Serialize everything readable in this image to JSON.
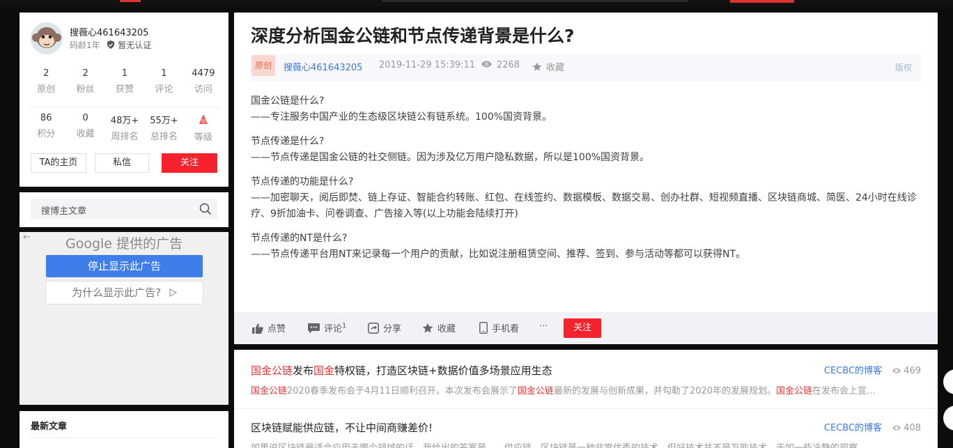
{
  "sidebar": {
    "profile": {
      "username": "搜薇心461643205",
      "code_age": "码龄1年",
      "verify": "暂无认证",
      "stats_row1": [
        {
          "num": "2",
          "label": "原创"
        },
        {
          "num": "2",
          "label": "粉丝"
        },
        {
          "num": "1",
          "label": "获赞"
        },
        {
          "num": "1",
          "label": "评论"
        },
        {
          "num": "4479",
          "label": "访问"
        }
      ],
      "stats_row2": [
        {
          "num": "86",
          "label": "积分"
        },
        {
          "num": "0",
          "label": "收藏"
        },
        {
          "num": "48万+",
          "label": "周排名"
        },
        {
          "num": "55万+",
          "label": "总排名"
        },
        {
          "num": "",
          "label": "等级"
        }
      ],
      "homepage_label": "TA的主页",
      "message_label": "私信",
      "follow_label": "关注"
    },
    "search": {
      "placeholder": "搜博主文章"
    },
    "ad": {
      "google_label": "Google 提供的广告",
      "stop_label": "停止显示此广告",
      "why_label": "为什么显示此广告?"
    },
    "recent": {
      "title": "最新文章"
    }
  },
  "article": {
    "title": "深度分析国金公链和节点传递背景是什么?",
    "badge": "原创",
    "author": "搜薇心461643205",
    "time": "2019-11-29 15:39:11",
    "views": "2268",
    "favorite": "收藏",
    "copyright": "版权",
    "paragraphs": [
      [
        "国金公链是什么?",
        "——专注服务中国产业的生态级区块链公有链系统。100%国资背景。"
      ],
      [
        "节点传递是什么?",
        "——节点传递是国金公链的社交侧链。因为涉及亿万用户隐私数据，所以是100%国资背景。"
      ],
      [
        "节点传递的功能是什么?",
        "——加密聊天，阅后即焚、链上存证、智能合约转账、红包、在线签约、数据模板、数据交易、创办社群、短视频直播、区块链商城、简医、24小时在线诊疗、9折加油卡、问卷调查、广告接入等(以上功能会陆续打开)"
      ],
      [
        "节点传递的NT是什么?",
        "——节点传递平台用NT来记录每一个用户的贡献，比如说注册租赁空间、推荐、签到、参与活动等都可以获得NT。"
      ]
    ],
    "actions": {
      "like": "点赞",
      "comment": "评论",
      "comment_count": "1",
      "share": "分享",
      "favorite": "收藏",
      "mobile": "手机看",
      "more": "···",
      "follow": "关注"
    }
  },
  "recommendations": [
    {
      "title_parts": [
        [
          "国金公链",
          true
        ],
        [
          "发布",
          false
        ],
        [
          "国金",
          true
        ],
        [
          "特权链，打造区块链+数据价值多场景应用生态",
          false
        ]
      ],
      "desc_parts": [
        [
          "国金公链",
          true
        ],
        [
          "2020春季发布会于4月11日顺利召开。本次发布会展示了",
          false
        ],
        [
          "国金公链",
          true
        ],
        [
          "最新的发展与创新成果，并勾勒了2020年的发展规划。",
          false
        ],
        [
          "国金公链",
          true
        ],
        [
          "在发布会上宣...",
          false
        ]
      ],
      "blog": "CECBC的博客",
      "views": "469"
    },
    {
      "title_parts": [
        [
          "区块链赋能供应链，不让中间商赚差价!",
          false
        ]
      ],
      "desc_parts": [
        [
          "如果说区块链最适合应用于哪个领域的话，我给出的答案是——供应链。区块链是一种非常优秀的技术，但好技术并不是万能技术，于如一些冷静的观察...",
          false
        ]
      ],
      "blog": "CECBC的博客",
      "views": "408"
    }
  ],
  "colors": {
    "accent_red": "#f5222d",
    "link_blue": "#3c78d8",
    "highlight_red": "#e53333"
  }
}
